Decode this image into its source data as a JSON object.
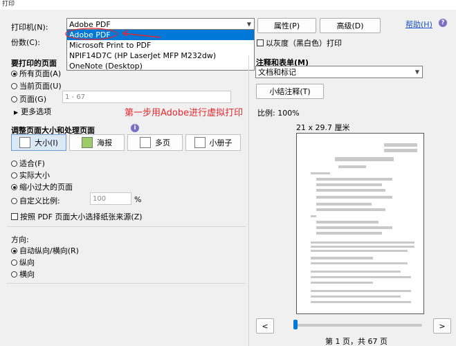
{
  "window": {
    "title": "打印"
  },
  "printer": {
    "label": "打印机(N):",
    "selected": "Adobe PDF",
    "options": [
      "Adobe PDF",
      "Microsoft Print to PDF",
      "NPIF14D7C (HP LaserJet MFP M232dw)",
      "OneNote (Desktop)"
    ],
    "copies_label": "份数(C):",
    "properties_label": "属性(P)",
    "advanced_label": "高级(D)",
    "help_label": "帮助(H)",
    "grayscale_label": "以灰度（黑白色）打印"
  },
  "pages": {
    "heading": "要打印的页面",
    "all": "所有页面(A)",
    "current": "当前页面(U)",
    "range": "页面(G)",
    "range_value": "1 - 67",
    "more": "更多选项"
  },
  "annotation_text": "第一步用Adobe进行虚拟打印",
  "sizing": {
    "heading": "调整页面大小和处理页面",
    "tabs": [
      "大小(I)",
      "海报",
      "多页",
      "小册子"
    ],
    "fit": "适合(F)",
    "actual": "实际大小",
    "shrink": "缩小过大的页面",
    "custom": "自定义比例:",
    "custom_value": "100",
    "percent": "%",
    "paper_source": "按照 PDF 页面大小选择纸张来源(Z)"
  },
  "orientation": {
    "heading": "方向:",
    "auto": "自动纵向/横向(R)",
    "portrait": "纵向",
    "landscape": "横向"
  },
  "comments": {
    "heading": "注释和表单(M)",
    "selected": "文档和标记",
    "summarize": "小结注释(T)"
  },
  "preview": {
    "scale": "比例:  100%",
    "paper_size": "21 x 29.7 厘米",
    "page_label": "第 1 页，共 67 页",
    "slider_fraction": 0,
    "prev": "<",
    "next": ">"
  },
  "icons": {
    "dropdown": "chevron-down-icon",
    "info": "info-icon",
    "expand": "triangle-right-icon"
  },
  "colors": {
    "accent": "#0078d7",
    "annotation": "#e8262d",
    "link": "#1a50c8"
  }
}
